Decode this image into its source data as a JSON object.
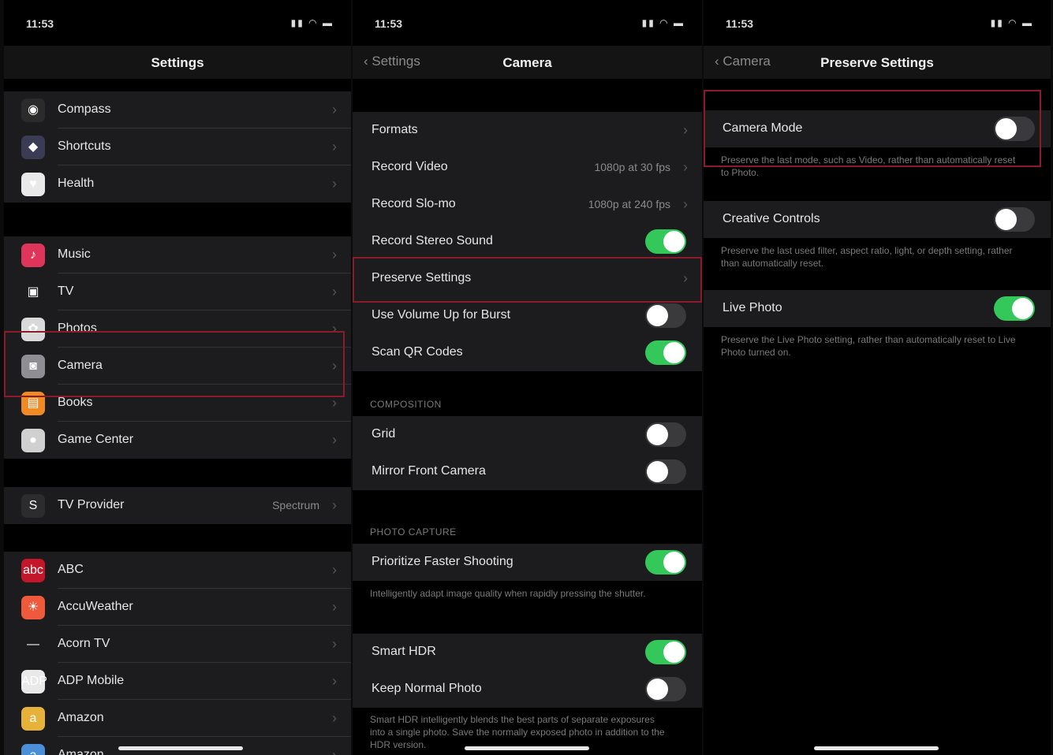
{
  "status": {
    "time": "11:53",
    "icons": "▮▮ ◠ ▬"
  },
  "panel1": {
    "title": "Settings",
    "group1": [
      {
        "label": "Compass",
        "icon": "compass-icon",
        "glyph": "◉",
        "color": "#2b2b2b"
      },
      {
        "label": "Shortcuts",
        "icon": "shortcuts-icon",
        "glyph": "◆",
        "color": "#3b3b55"
      },
      {
        "label": "Health",
        "icon": "health-icon",
        "glyph": "♥",
        "color": "#e9e9e9"
      }
    ],
    "group2": [
      {
        "label": "Music",
        "icon": "music-icon",
        "glyph": "♪",
        "color": "#e0355b"
      },
      {
        "label": "TV",
        "icon": "tv-icon",
        "glyph": "▣",
        "color": "#1c1c1e"
      },
      {
        "label": "Photos",
        "icon": "photos-icon",
        "glyph": "✿",
        "color": "#d9d9d9"
      },
      {
        "label": "Camera",
        "icon": "camera-icon",
        "glyph": "◙",
        "color": "#8e8e93"
      },
      {
        "label": "Books",
        "icon": "books-icon",
        "glyph": "▤",
        "color": "#f08a24"
      },
      {
        "label": "Game Center",
        "icon": "game-center-icon",
        "glyph": "●",
        "color": "#d0d0d0"
      }
    ],
    "group3": [
      {
        "label": "TV Provider",
        "icon": "tv-provider-icon",
        "glyph": "S",
        "color": "#2c2c2e",
        "value": "Spectrum"
      }
    ],
    "group4": [
      {
        "label": "ABC",
        "icon": "abc-icon",
        "glyph": "abc",
        "color": "#c4162a"
      },
      {
        "label": "AccuWeather",
        "icon": "accuweather-icon",
        "glyph": "☀",
        "color": "#ef5a3c"
      },
      {
        "label": "Acorn TV",
        "icon": "acorn-tv-icon",
        "glyph": "—",
        "color": "#1c1c1e"
      },
      {
        "label": "ADP Mobile",
        "icon": "adp-mobile-icon",
        "glyph": "ADP",
        "color": "#e9e9e9"
      },
      {
        "label": "Amazon",
        "icon": "amazon-icon",
        "glyph": "a",
        "color": "#e7b23a"
      },
      {
        "label": "Amazon",
        "icon": "amazon-icon",
        "glyph": "a",
        "color": "#4a8fd8"
      }
    ]
  },
  "panel2": {
    "back": "Settings",
    "title": "Camera",
    "group1": [
      {
        "label": "Formats",
        "type": "chev"
      },
      {
        "label": "Record Video",
        "type": "value",
        "value": "1080p at 30 fps"
      },
      {
        "label": "Record Slo-mo",
        "type": "value",
        "value": "1080p at 240 fps"
      },
      {
        "label": "Record Stereo Sound",
        "type": "toggle",
        "on": true
      },
      {
        "label": "Preserve Settings",
        "type": "chev"
      },
      {
        "label": "Use Volume Up for Burst",
        "type": "toggle",
        "on": false
      },
      {
        "label": "Scan QR Codes",
        "type": "toggle",
        "on": true
      }
    ],
    "composition_header": "COMPOSITION",
    "group2": [
      {
        "label": "Grid",
        "type": "toggle",
        "on": false
      },
      {
        "label": "Mirror Front Camera",
        "type": "toggle",
        "on": false
      }
    ],
    "photo_capture_header": "PHOTO CAPTURE",
    "group3": [
      {
        "label": "Prioritize Faster Shooting",
        "type": "toggle",
        "on": true
      }
    ],
    "group3_footer": "Intelligently adapt image quality when rapidly pressing the shutter.",
    "group4": [
      {
        "label": "Smart HDR",
        "type": "toggle",
        "on": true
      },
      {
        "label": "Keep Normal Photo",
        "type": "toggle",
        "on": false
      }
    ],
    "group4_footer": "Smart HDR intelligently blends the best parts of separate exposures into a single photo. Save the normally exposed photo in addition to the HDR version."
  },
  "panel3": {
    "back": "Camera",
    "title": "Preserve Settings",
    "items": [
      {
        "label": "Camera Mode",
        "on": false,
        "footer": "Preserve the last mode, such as Video, rather than automatically reset to Photo."
      },
      {
        "label": "Creative Controls",
        "on": false,
        "footer": "Preserve the last used filter, aspect ratio, light, or depth setting, rather than automatically reset."
      },
      {
        "label": "Live Photo",
        "on": true,
        "footer": "Preserve the Live Photo setting, rather than automatically reset to Live Photo turned on."
      }
    ]
  },
  "colors": {
    "accent_highlight": "#8b1a2a",
    "toggle_on": "#34c759"
  }
}
